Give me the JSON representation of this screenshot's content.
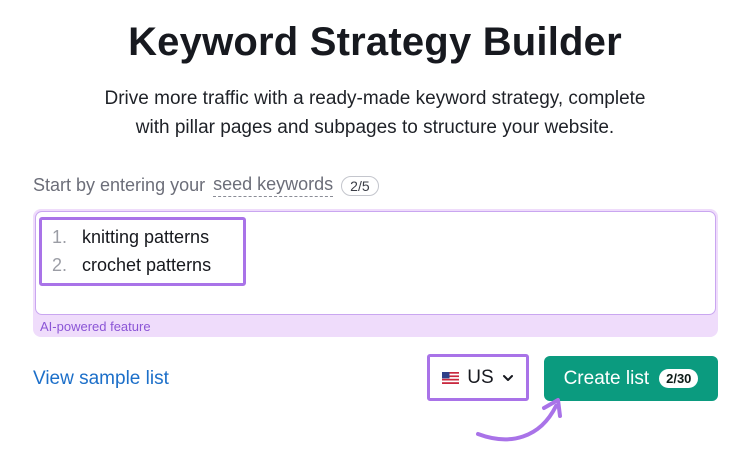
{
  "header": {
    "title": "Keyword Strategy Builder",
    "subtitle_line1": "Drive more traffic with a ready-made keyword strategy, complete",
    "subtitle_line2": "with pillar pages and subpages to structure your website."
  },
  "seed": {
    "prefix": "Start by entering your",
    "link_text": "seed keywords",
    "count": "2/5"
  },
  "keywords": {
    "items": [
      {
        "number": "1.",
        "text": "knitting patterns"
      },
      {
        "number": "2.",
        "text": "crochet patterns"
      }
    ],
    "ai_label": "AI-powered feature"
  },
  "actions": {
    "sample_link": "View sample list",
    "country": "US",
    "country_flag_icon": "us-flag-icon",
    "create_label": "Create list",
    "create_count": "2/30"
  },
  "colors": {
    "accent_green": "#0b9b7f",
    "highlight_purple": "#a973e8",
    "ai_bg": "#efdcfb",
    "link_blue": "#1c6fc9"
  }
}
